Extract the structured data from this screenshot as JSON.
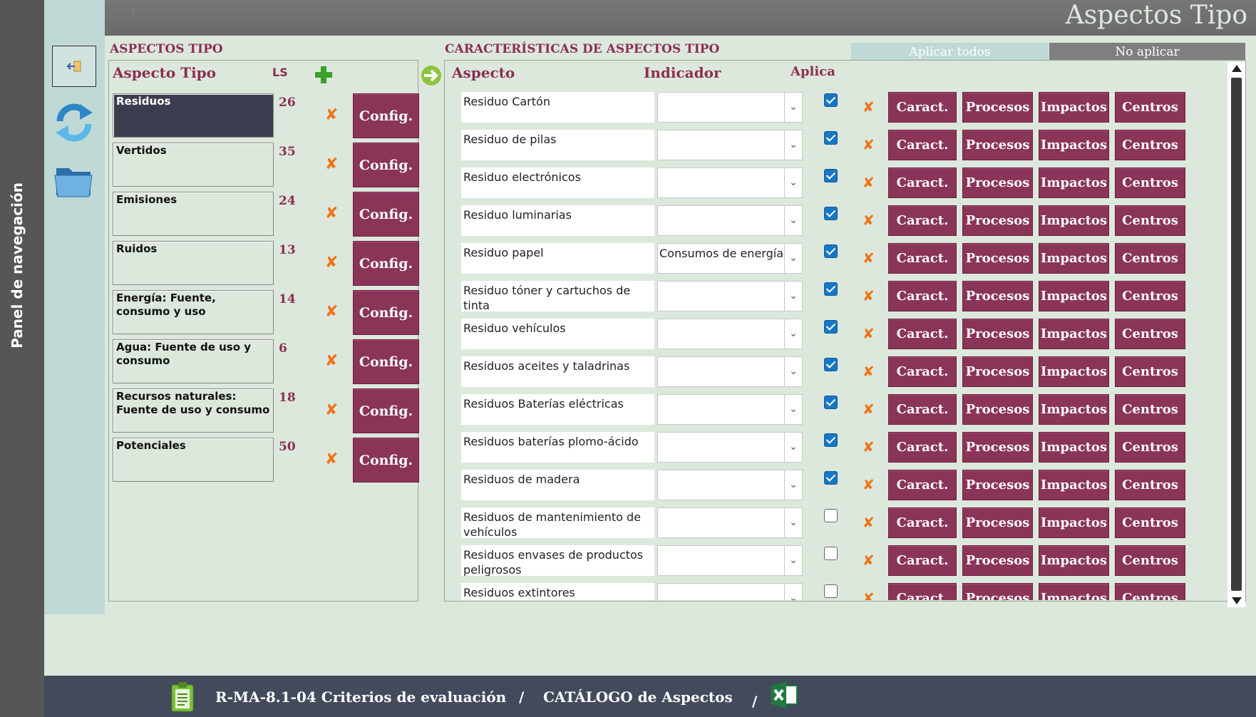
{
  "nav": {
    "label": "Panel de navegación"
  },
  "header": {
    "title": "Aspectos Tipo"
  },
  "left": {
    "section_title": "ASPECTOS TIPO",
    "col_aspecto_tipo": "Aspecto Tipo",
    "col_ls": "LS",
    "config_label": "Config.",
    "rows": [
      {
        "name": "Residuos",
        "ls": "26"
      },
      {
        "name": "Vertidos",
        "ls": "35"
      },
      {
        "name": "Emisiones",
        "ls": "24"
      },
      {
        "name": "Ruidos",
        "ls": "13"
      },
      {
        "name": "Energía: Fuente, consumo y uso",
        "ls": "14"
      },
      {
        "name": "Agua: Fuente  de uso y consumo",
        "ls": "6"
      },
      {
        "name": "Recursos naturales: Fuente de uso  y consumo",
        "ls": "18"
      },
      {
        "name": "Potenciales",
        "ls": "50"
      }
    ]
  },
  "right": {
    "section_title": "CARACTERÍSTICAS DE ASPECTOS TIPO",
    "apply_all": "Aplicar todos",
    "no_apply": "No aplicar",
    "col_aspecto": "Aspecto",
    "col_indicador": "Indicador",
    "col_aplica": "Aplica",
    "btn_caract": "Caract.",
    "btn_procesos": "Procesos",
    "btn_impactos": "Impactos",
    "btn_centros": "Centros",
    "rows": [
      {
        "aspecto": "Residuo Cartón",
        "indicador": "",
        "aplica": true
      },
      {
        "aspecto": "Residuo de pilas",
        "indicador": "",
        "aplica": true
      },
      {
        "aspecto": "Residuo electrónicos",
        "indicador": "",
        "aplica": true
      },
      {
        "aspecto": "Residuo luminarias",
        "indicador": "",
        "aplica": true
      },
      {
        "aspecto": "Residuo papel",
        "indicador": "Consumos de energía",
        "aplica": true
      },
      {
        "aspecto": "Residuo tóner y cartuchos de tinta",
        "indicador": "",
        "aplica": true
      },
      {
        "aspecto": "Residuo vehículos",
        "indicador": "",
        "aplica": true
      },
      {
        "aspecto": "Residuos aceites y taladrinas",
        "indicador": "",
        "aplica": true
      },
      {
        "aspecto": "Residuos Baterías eléctricas",
        "indicador": "",
        "aplica": true
      },
      {
        "aspecto": "Residuos baterías plomo-ácido",
        "indicador": "",
        "aplica": true
      },
      {
        "aspecto": "Residuos de madera",
        "indicador": "",
        "aplica": true
      },
      {
        "aspecto": "Residuos de mantenimiento de vehículos",
        "indicador": "",
        "aplica": false
      },
      {
        "aspecto": "Residuos envases de productos peligrosos",
        "indicador": "",
        "aplica": false
      },
      {
        "aspecto": "Residuos extintores",
        "indicador": "",
        "aplica": false
      }
    ]
  },
  "footer": {
    "doc_label": "R-MA-8.1-04 Criterios de evaluación",
    "sep1": "/",
    "catalog_label": "CATÁLOGO de Aspectos",
    "sep2": "/"
  },
  "colors": {
    "accent": "#8a3458",
    "header_text": "#8b2f52",
    "check_blue": "#1777c5",
    "x_orange": "#f07318",
    "selected_row": "#3b3d4e"
  }
}
